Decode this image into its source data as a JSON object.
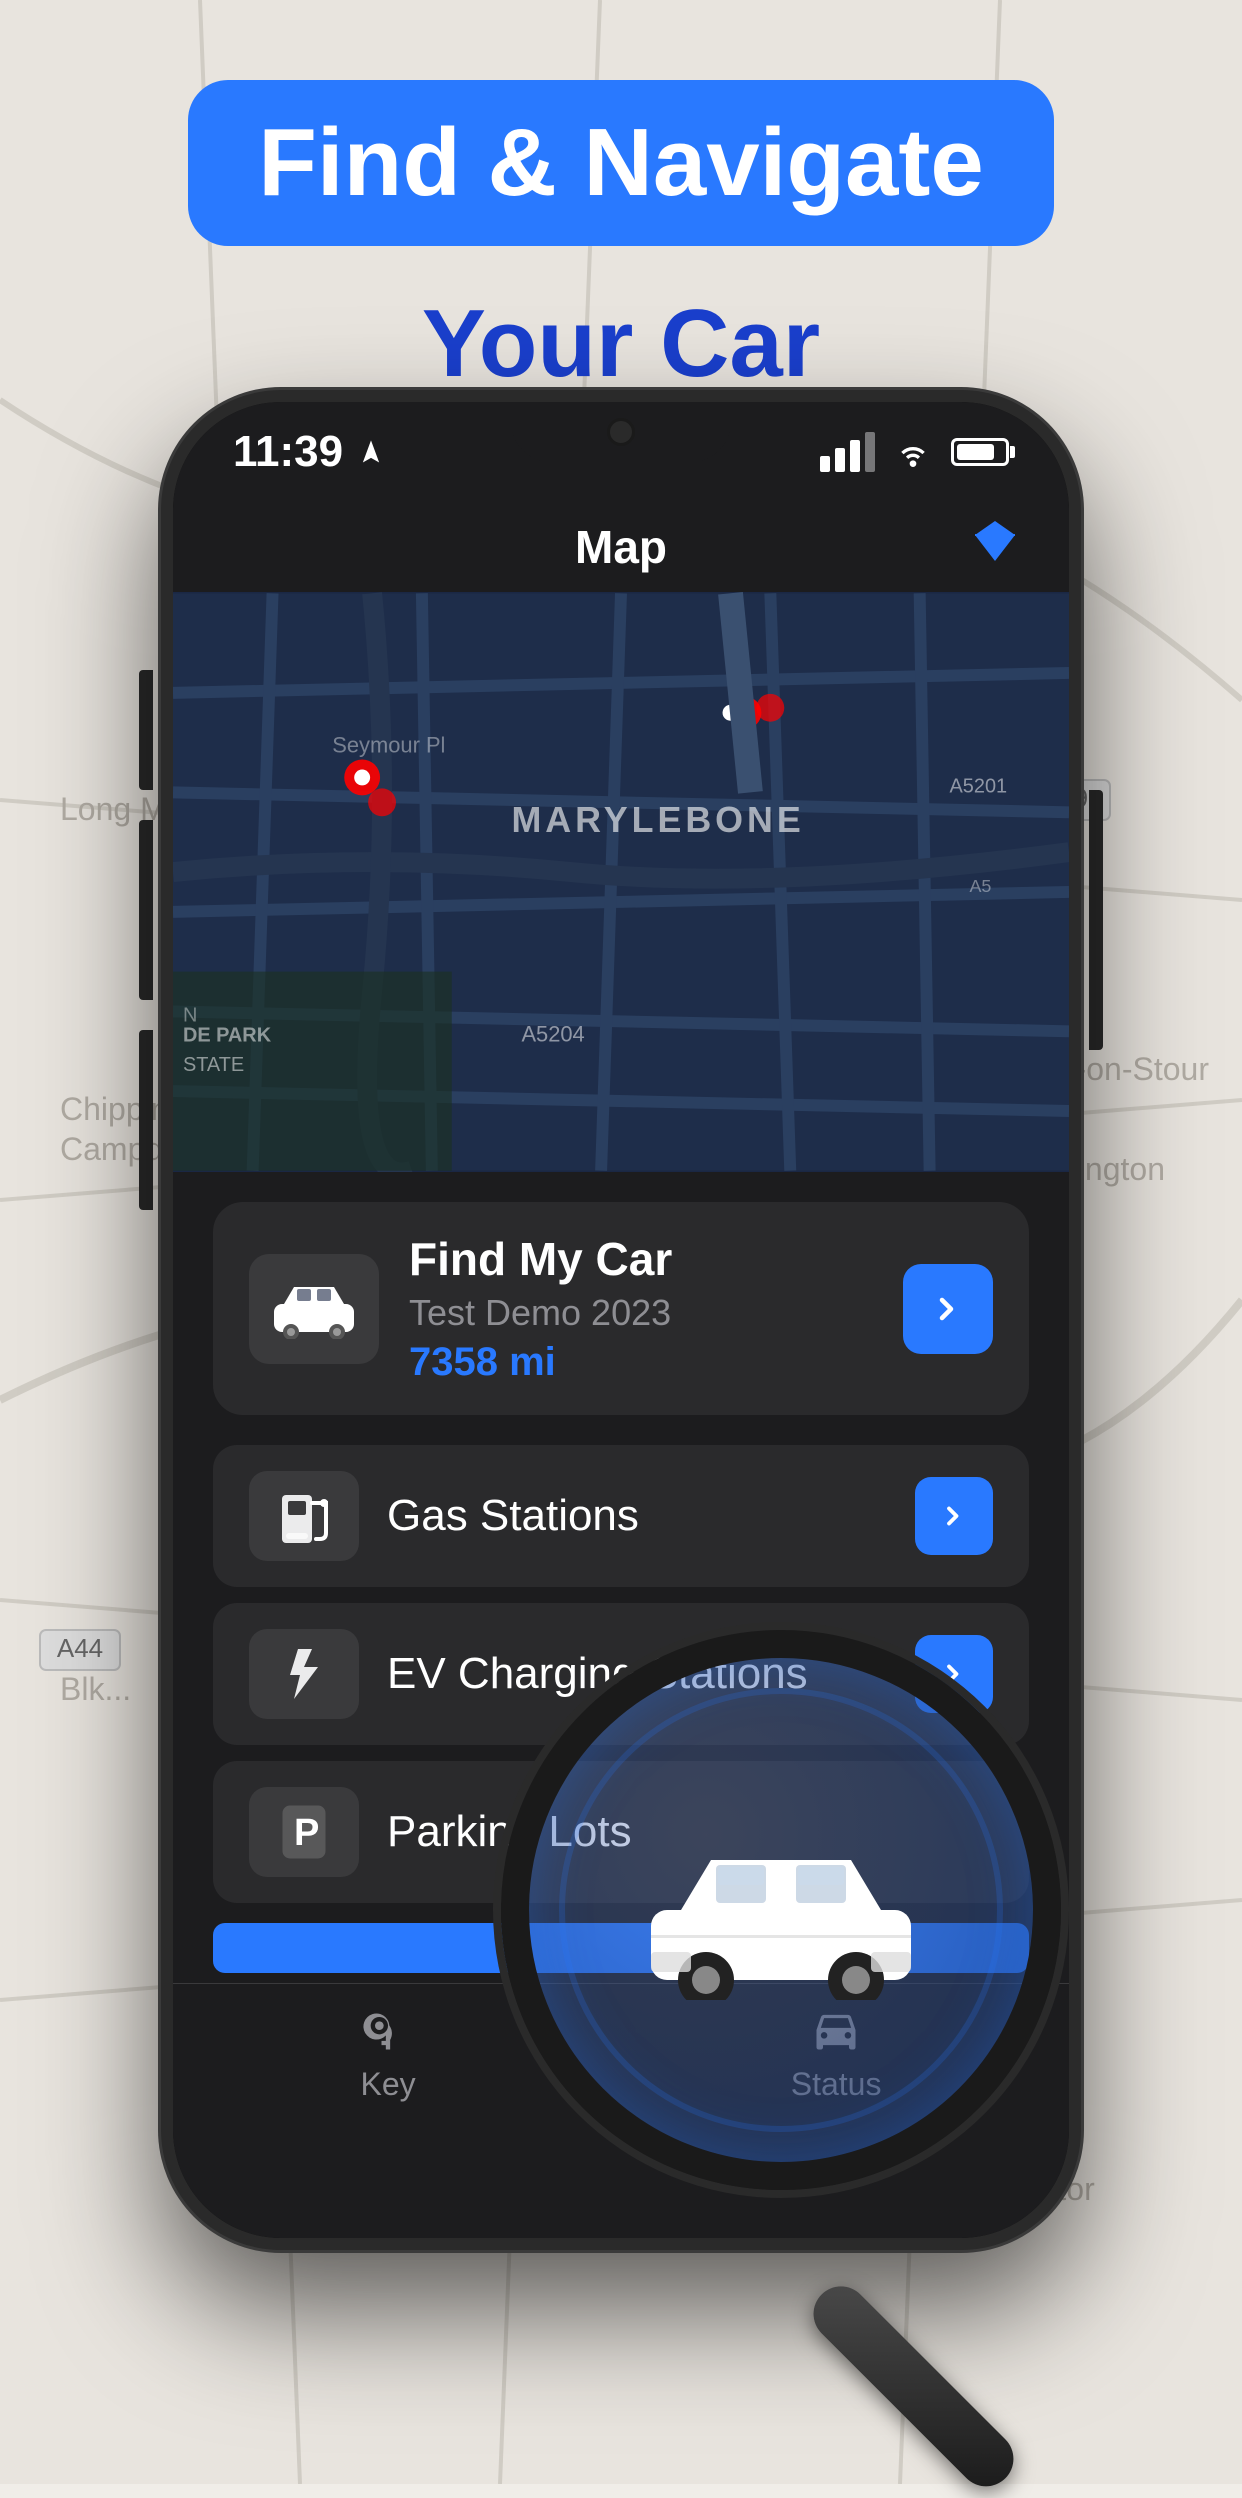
{
  "header": {
    "title_line1": "Find & Navigate",
    "title_line2": "Your Car"
  },
  "phone": {
    "status_bar": {
      "time": "11:39",
      "location_arrow": "▶",
      "signal_level": 3,
      "wifi": true,
      "battery_percent": 80
    },
    "app": {
      "title": "Map",
      "diamond_icon": "💎"
    },
    "map": {
      "location_label": "MARYLEBONE"
    },
    "find_car_card": {
      "title": "Find My Car",
      "subtitle": "Test Demo 2023",
      "distance": "7358 mi"
    },
    "menu_items": [
      {
        "id": "gas",
        "label": "Gas Stations",
        "icon": "gas"
      },
      {
        "id": "ev",
        "label": "EV Charging Stations",
        "icon": "ev"
      },
      {
        "id": "parking",
        "label": "Parking Lots",
        "icon": "parking"
      }
    ],
    "tab_bar": {
      "tabs": [
        {
          "id": "key",
          "label": "Key",
          "icon": "🔑"
        },
        {
          "id": "status",
          "label": "Status",
          "icon": "🚗"
        }
      ]
    }
  },
  "colors": {
    "accent": "#2979FF",
    "background_dark": "#1c1c1e",
    "card_bg": "#2a2a2c",
    "icon_bg": "#3a3a3c",
    "text_primary": "#ffffff",
    "text_secondary": "#8e8e93",
    "map_bg": "#1a2744"
  }
}
